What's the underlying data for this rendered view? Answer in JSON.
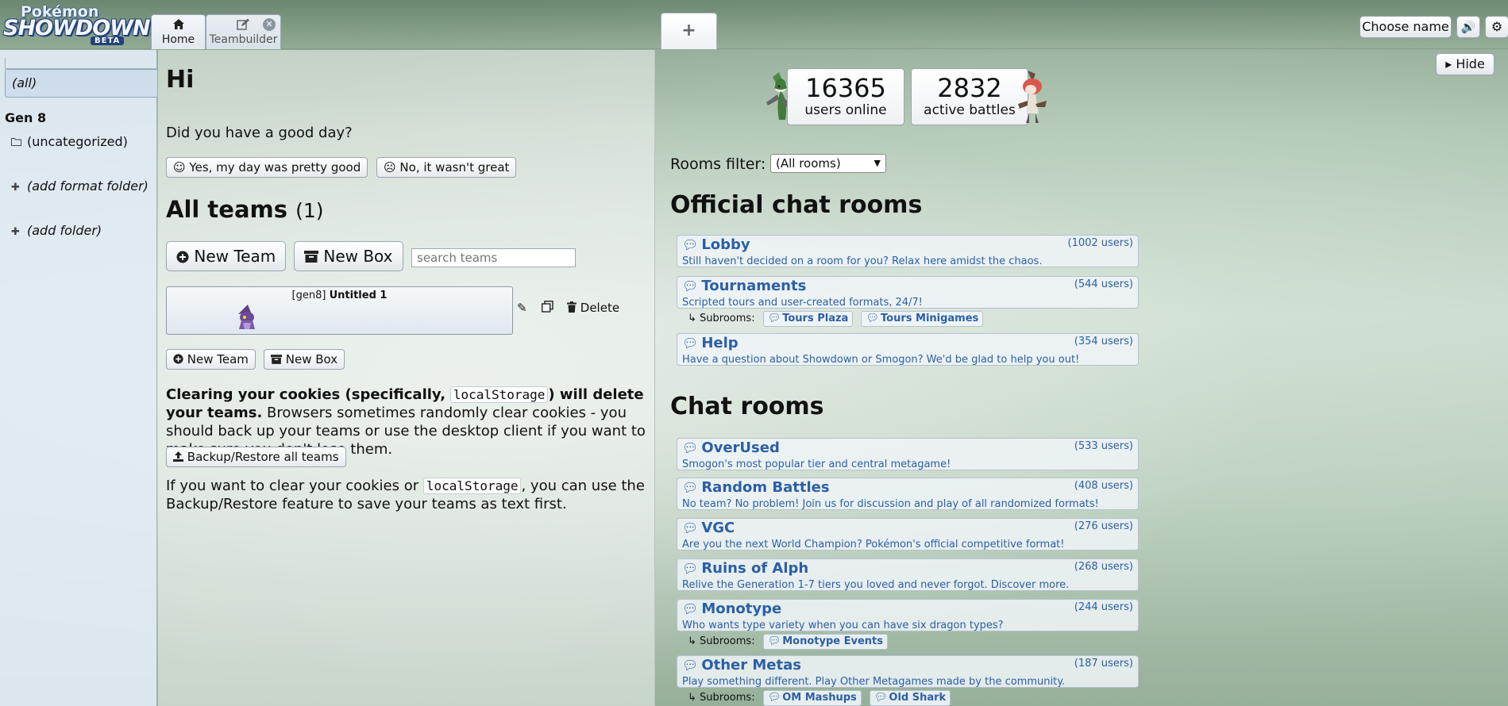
{
  "header": {
    "logo_line1": "Pokémon",
    "logo_line2": "SHOWDOWN!",
    "logo_badge": "BETA",
    "tabs": [
      {
        "label": "Home",
        "icon": "home-icon"
      },
      {
        "label": "Teambuilder",
        "icon": "pencil-square-icon"
      }
    ],
    "new_tab_label": "+",
    "choose_name_label": "Choose name",
    "sound_icon": "🔊",
    "gear_icon": "⚙"
  },
  "folders": {
    "all_label": "(all)",
    "gen_label": "Gen 8",
    "uncategorized_label": "(uncategorized)",
    "add_format_folder_label": "(add format folder)",
    "add_folder_label": "(add folder)"
  },
  "teambuilder": {
    "greeting": "Hi",
    "question": "Did you have a good day?",
    "yes_label": "Yes, my day was pretty good",
    "no_label": "No, it wasn't great",
    "all_teams_label": "All teams",
    "team_count": "(1)",
    "new_team_label": "New Team",
    "new_box_label": "New Box",
    "search_placeholder": "search teams",
    "team": {
      "format": "[gen8]",
      "name": "Untitled 1"
    },
    "delete_label": "Delete",
    "warning_bold_1": "Clearing your cookies (specifically,",
    "warning_code": "localStorage",
    "warning_bold_2": ") will delete your teams.",
    "warning_rest": " Browsers sometimes randomly clear cookies - you should back up your teams or use the desktop client if you want to make sure you don't lose them.",
    "backup_label": "Backup/Restore all teams",
    "clear_1": "If you want to clear your cookies or",
    "clear_code": "localStorage",
    "clear_2": ", you can use the Backup/Restore feature to save your teams as text first."
  },
  "main": {
    "hide_label": "Hide",
    "users_online": "16365",
    "users_online_label": "users online",
    "active_battles": "2832",
    "active_battles_label": "active battles",
    "rooms_filter_label": "Rooms filter:",
    "rooms_filter_value": "(All rooms)",
    "official_heading": "Official chat rooms",
    "chat_heading": "Chat rooms",
    "subrooms_label": "Subrooms:",
    "official_rooms": [
      {
        "name": "Lobby",
        "users": "(1002 users)",
        "desc": "Still haven't decided on a room for you? Relax here amidst the chaos."
      },
      {
        "name": "Tournaments",
        "users": "(544 users)",
        "desc": "Scripted tours and user-created formats, 24/7!",
        "subrooms": [
          "Tours Plaza",
          "Tours Minigames"
        ]
      },
      {
        "name": "Help",
        "users": "(354 users)",
        "desc": "Have a question about Showdown or Smogon? We'd be glad to help you out!"
      }
    ],
    "chat_rooms": [
      {
        "name": "OverUsed",
        "users": "(533 users)",
        "desc": "Smogon's most popular tier and central metagame!"
      },
      {
        "name": "Random Battles",
        "users": "(408 users)",
        "desc": "No team? No problem! Join us for discussion and play of all randomized formats!"
      },
      {
        "name": "VGC",
        "users": "(276 users)",
        "desc": "Are you the next World Champion? Pokémon's official competitive format!"
      },
      {
        "name": "Ruins of Alph",
        "users": "(268 users)",
        "desc": "Relive the Generation 1-7 tiers you loved and never forgot. Discover more."
      },
      {
        "name": "Monotype",
        "users": "(244 users)",
        "desc": "Who wants type variety when you can have six dragon types?",
        "subrooms": [
          "Monotype Events"
        ]
      },
      {
        "name": "Other Metas",
        "users": "(187 users)",
        "desc": "Play something different. Play Other Metagames made by the community.",
        "subrooms": [
          "OM Mashups",
          "Old Shark"
        ]
      }
    ]
  }
}
